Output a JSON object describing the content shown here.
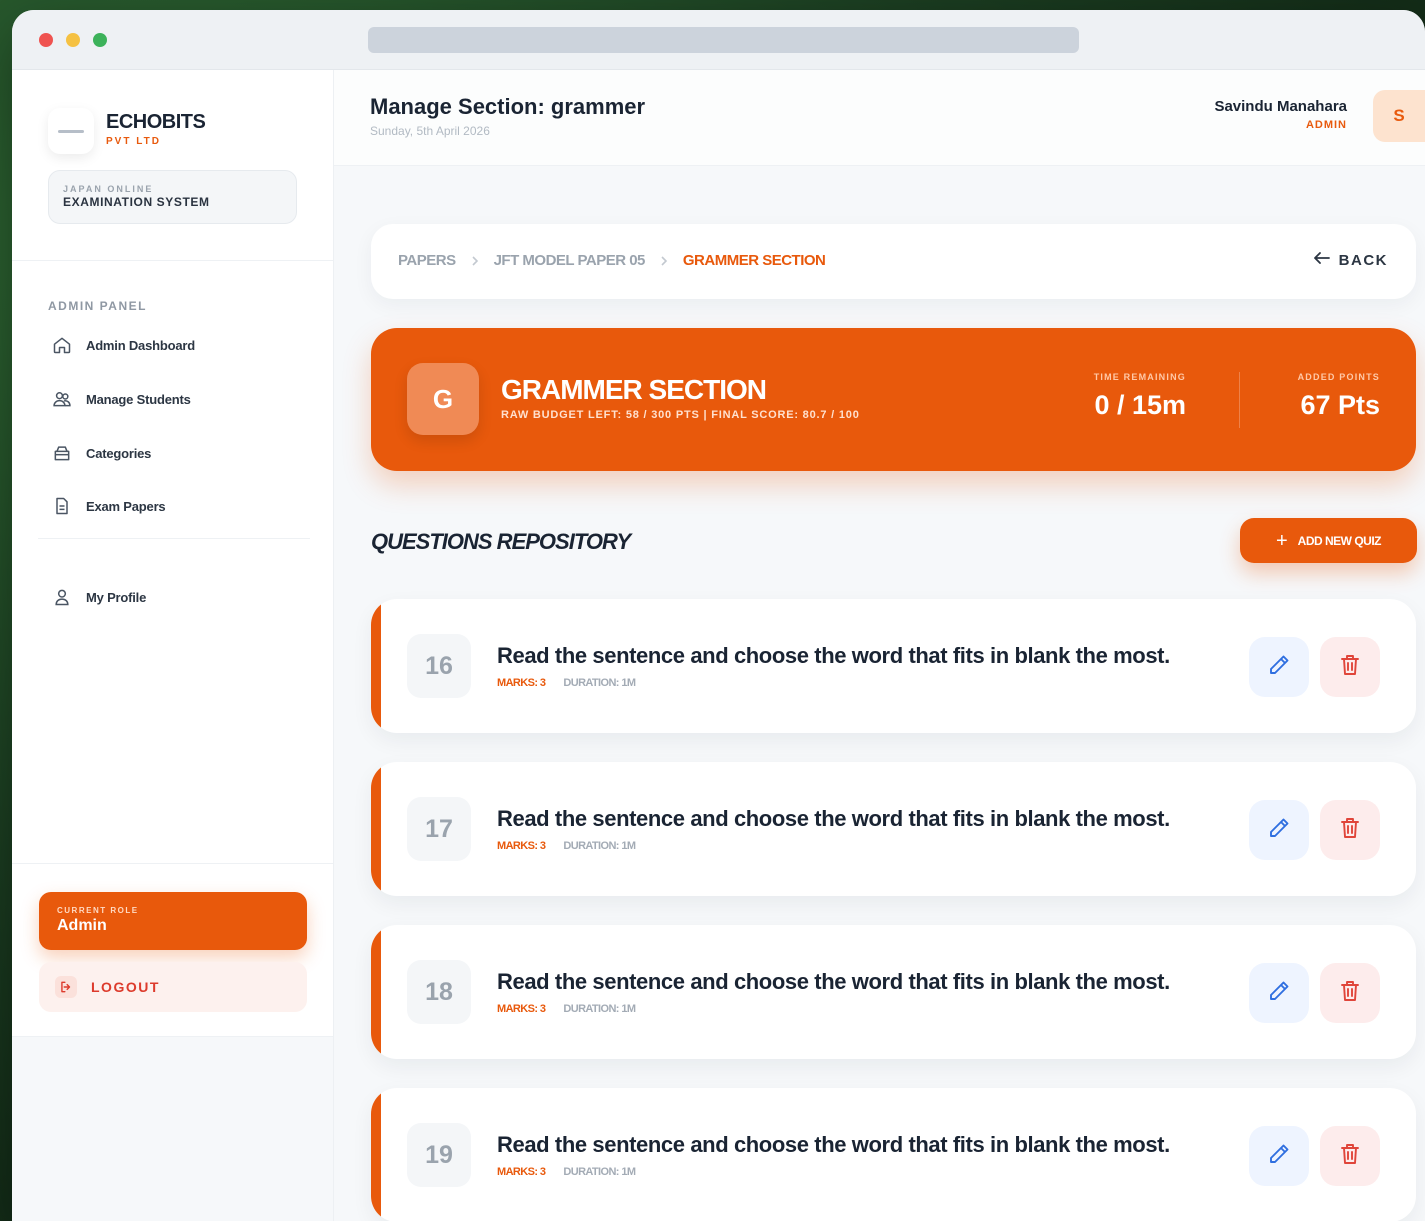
{
  "brand": {
    "name": "ECHOBITS",
    "sub": "PVT LTD",
    "system_top": "JAPAN ONLINE",
    "system_bottom": "EXAMINATION SYSTEM"
  },
  "sidebar": {
    "section_label": "ADMIN PANEL",
    "items": [
      {
        "label": "Admin Dashboard",
        "icon": "home-icon"
      },
      {
        "label": "Manage Students",
        "icon": "users-icon"
      },
      {
        "label": "Categories",
        "icon": "folder-icon"
      },
      {
        "label": "Exam Papers",
        "icon": "document-icon"
      }
    ],
    "profile": {
      "label": "My Profile",
      "icon": "user-icon"
    },
    "role": {
      "label": "CURRENT ROLE",
      "value": "Admin"
    },
    "logout_label": "LOGOUT"
  },
  "header": {
    "title": "Manage Section: grammer",
    "date": "Sunday, 5th April 2026",
    "user_name": "Savindu Manahara",
    "user_role": "ADMIN",
    "avatar_initial": "S"
  },
  "breadcrumb": {
    "items": [
      "PAPERS",
      "JFT MODEL PAPER 05",
      "GRAMMER SECTION"
    ],
    "back_label": "BACK"
  },
  "section": {
    "badge": "G",
    "title": "GRAMMER SECTION",
    "subtitle": "RAW BUDGET LEFT: 58 / 300 PTS  |  FINAL SCORE: 80.7 / 100",
    "time_label": "TIME REMAINING",
    "time_value": "0 / 15m",
    "points_label": "ADDED POINTS",
    "points_value": "67 Pts"
  },
  "repository": {
    "title": "QUESTIONS REPOSITORY",
    "add_label": "ADD NEW QUIZ",
    "questions": [
      {
        "number": "16",
        "text": "Read the sentence and choose the word that fits in blank the most.",
        "marks": "MARKS: 3",
        "duration": "DURATION: 1M"
      },
      {
        "number": "17",
        "text": "Read the sentence and choose the word that fits in blank the most.",
        "marks": "MARKS: 3",
        "duration": "DURATION: 1M"
      },
      {
        "number": "18",
        "text": "Read the sentence and choose the word that fits in blank the most.",
        "marks": "MARKS: 3",
        "duration": "DURATION: 1M"
      },
      {
        "number": "19",
        "text": "Read the sentence and choose the word that fits in blank the most.",
        "marks": "MARKS: 3",
        "duration": "DURATION: 1M"
      }
    ]
  },
  "colors": {
    "accent": "#e8590c",
    "edit": "#2f6fe0",
    "delete": "#e0453a"
  }
}
